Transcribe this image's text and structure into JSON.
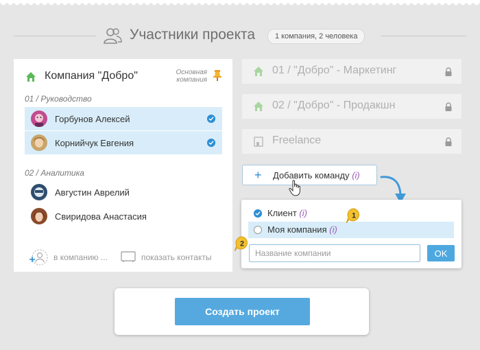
{
  "header": {
    "title": "Участники проекта",
    "badge": "1 компания, 2 человека"
  },
  "company": {
    "name": "Компания \"Добро\"",
    "main_label": "Основная компания",
    "groups": [
      {
        "label": "01 / Руководство",
        "members": [
          {
            "name": "Горбунов Алексей",
            "selected": true
          },
          {
            "name": "Корнийчук Евгения",
            "selected": true
          }
        ]
      },
      {
        "label": "02 / Аналитика",
        "members": [
          {
            "name": "Августин Аврелий",
            "selected": false
          },
          {
            "name": "Свиридова Анастасия",
            "selected": false
          }
        ]
      }
    ],
    "actions": {
      "add_member": "в компанию ...",
      "show_contacts": "показать контакты"
    }
  },
  "teams": [
    {
      "label": "01 / \"Добро\" - Маркетинг"
    },
    {
      "label": "02 / \"Добро\" - Продакшн"
    },
    {
      "label": "Freelance"
    }
  ],
  "add_team": {
    "plus": "+",
    "label": "Добавить команду",
    "info": "(i)"
  },
  "popup": {
    "options": [
      {
        "label": "Клиент",
        "info": "(i)",
        "checked": true
      },
      {
        "label": "Моя компания",
        "info": "(i)",
        "checked": false
      }
    ],
    "step1": "1",
    "step2": "2",
    "input_placeholder": "Название компании",
    "ok_label": "OK"
  },
  "footer": {
    "create_label": "Создать проект"
  },
  "colors": {
    "accent": "#2d8fd5",
    "button": "#55a9df",
    "house_green": "#5cb85c",
    "badge_yellow": "#f2c12e"
  }
}
